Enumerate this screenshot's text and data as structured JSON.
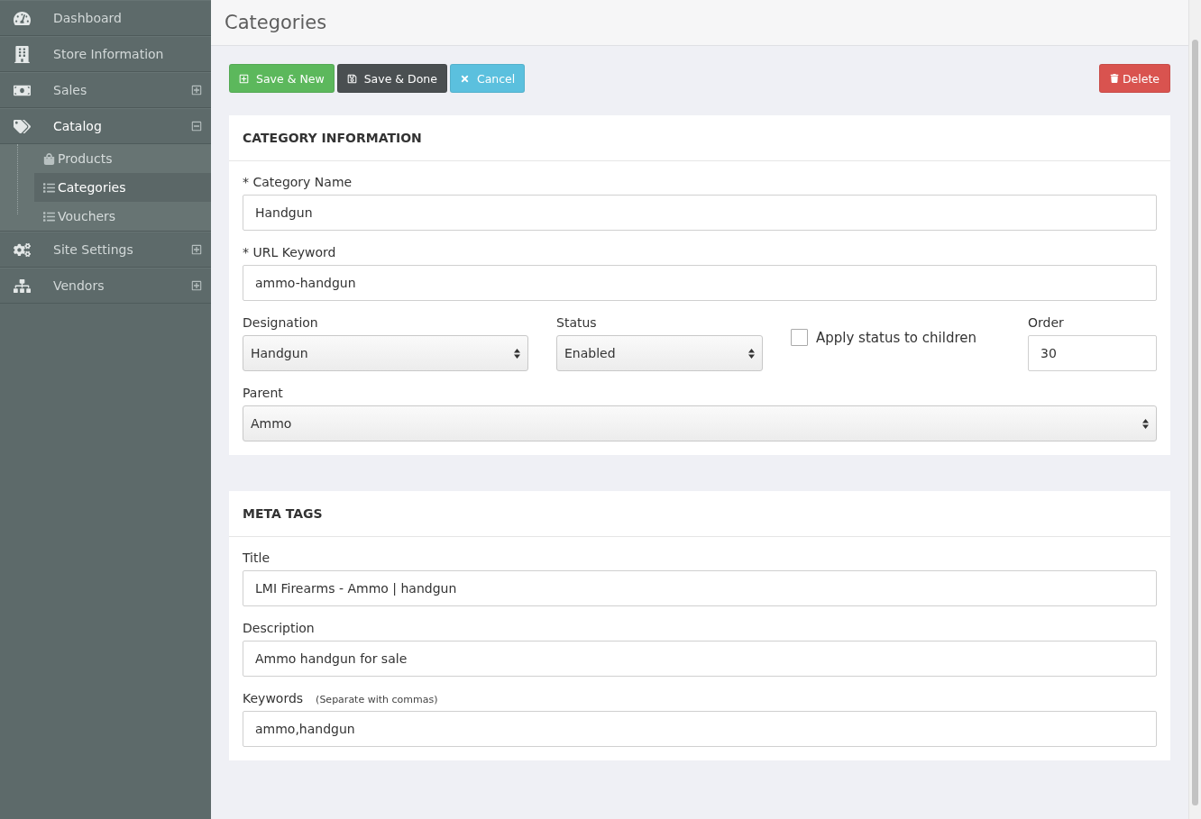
{
  "sidebar": {
    "items": [
      {
        "kind": "link",
        "label": "Dashboard"
      },
      {
        "kind": "link",
        "label": "Store Information"
      },
      {
        "kind": "group",
        "label": "Sales",
        "expanded": false
      },
      {
        "kind": "group",
        "label": "Catalog",
        "expanded": true,
        "children": [
          {
            "label": "Products",
            "selected": false
          },
          {
            "label": "Categories",
            "selected": true
          },
          {
            "label": "Vouchers",
            "selected": false
          }
        ]
      },
      {
        "kind": "group",
        "label": "Site Settings",
        "expanded": false
      },
      {
        "kind": "group",
        "label": "Vendors",
        "expanded": false
      }
    ]
  },
  "page": {
    "title": "Categories"
  },
  "toolbar": {
    "buttons": [
      {
        "kind": "success",
        "label": "Save & New"
      },
      {
        "kind": "dark",
        "label": "Save & Done"
      },
      {
        "kind": "info",
        "label": "Cancel"
      }
    ],
    "delete_button": {
      "label": "Delete"
    }
  },
  "sections": [
    {
      "title": "CATEGORY INFORMATION",
      "rows": [
        [
          {
            "kind": "text",
            "label": "* Category Name",
            "value": "Handgun"
          }
        ],
        [
          {
            "kind": "text",
            "label": "* URL Keyword",
            "value": "ammo-handgun"
          }
        ],
        [
          {
            "kind": "select",
            "label": "Designation",
            "value": "Handgun"
          },
          {
            "kind": "select",
            "label": "Status",
            "value": "Enabled"
          },
          {
            "kind": "checkbox",
            "label": "Apply status to children",
            "checked": false
          },
          {
            "kind": "text",
            "label": "Order",
            "value": "30"
          }
        ],
        [
          {
            "kind": "select",
            "label": "Parent",
            "value": "Ammo"
          }
        ]
      ]
    },
    {
      "title": "META TAGS",
      "rows": [
        [
          {
            "kind": "text",
            "label": "Title",
            "value": "LMI Firearms - Ammo | handgun"
          }
        ],
        [
          {
            "kind": "text",
            "label": "Description",
            "value": "Ammo handgun for sale"
          }
        ],
        [
          {
            "kind": "text",
            "label": "Keywords",
            "hint": "(Separate with commas)",
            "value": "ammo,handgun"
          }
        ]
      ]
    }
  ]
}
